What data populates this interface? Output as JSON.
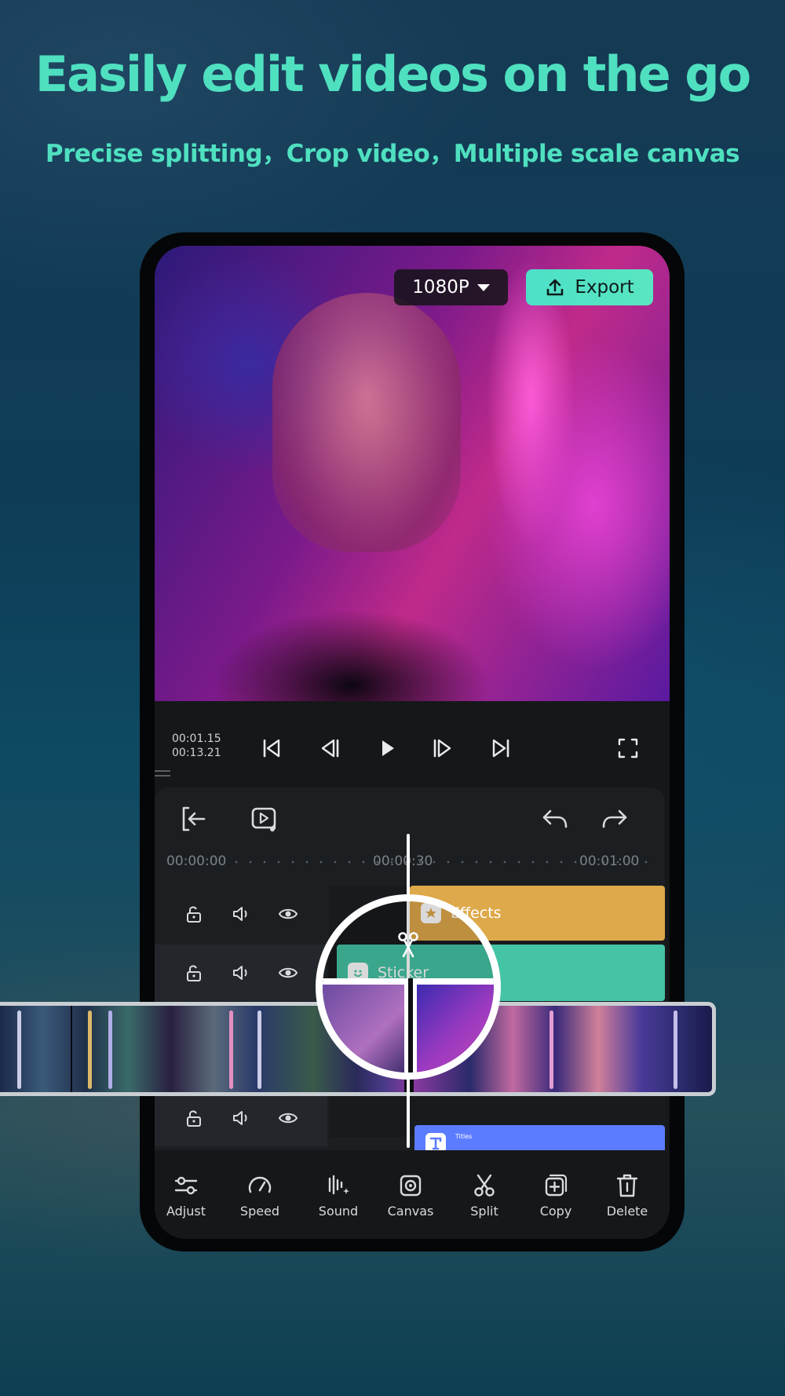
{
  "headline": "Easily edit videos on the go",
  "subheadline": "Precise splitting，Crop video，Multiple scale canvas",
  "editor": {
    "resolution": "1080P",
    "export_label": "Export",
    "current_time": "00:01.15",
    "total_time": "00:13.21",
    "ruler": [
      "00:00:00",
      "00:00:30",
      "00:01:00"
    ],
    "tracks": {
      "effects_label": "Effects",
      "sticker_label": "Sticker",
      "titles_label": "Titles"
    },
    "toolbar": [
      {
        "label": "Adjust",
        "icon": "sliders-icon"
      },
      {
        "label": "Speed",
        "icon": "speedometer-icon"
      },
      {
        "label": "Sound",
        "icon": "sound-icon"
      },
      {
        "label": "Canvas",
        "icon": "canvas-icon"
      },
      {
        "label": "Split",
        "icon": "scissors-icon"
      },
      {
        "label": "Copy",
        "icon": "copy-icon"
      },
      {
        "label": "Delete",
        "icon": "trash-icon"
      }
    ]
  },
  "colors": {
    "accent": "#4fe0c0",
    "effects_track": "#dea94a",
    "sticker_track": "#45c3a5",
    "titles_track": "#5c7cff"
  }
}
